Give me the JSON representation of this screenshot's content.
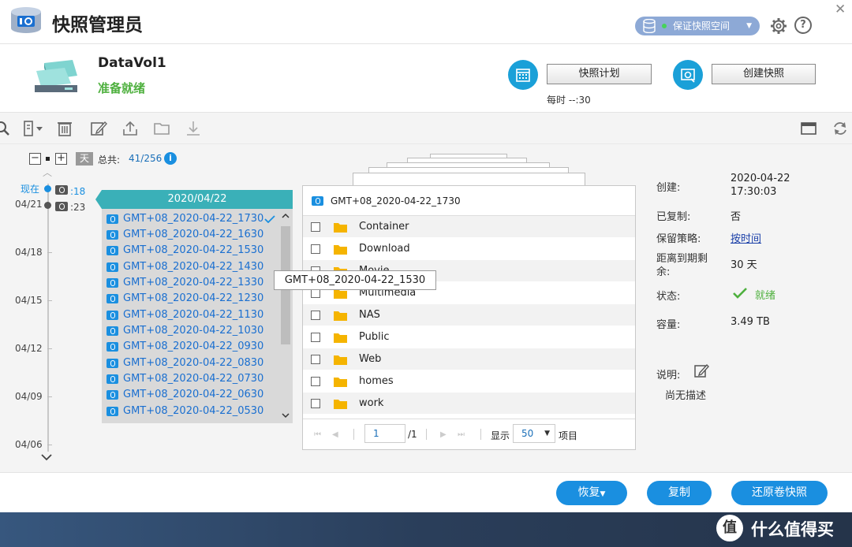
{
  "app": {
    "title": "快照管理员"
  },
  "header": {
    "guarantee_label": "保证快照空间",
    "help_label": "?",
    "close_label": "✕"
  },
  "volume": {
    "name": "DataVol1",
    "status": "准备就绪",
    "schedule_button": "快照计划",
    "schedule_text": "每时 --:30",
    "create_button": "创建快照"
  },
  "timeline": {
    "collapse_label": "−",
    "expand_label": "+",
    "day_label": "天",
    "total_label": "总共:",
    "total_value": "41/256",
    "now_label": "现在",
    "entries": [
      {
        "time": ":18",
        "color": "#1a8fe0"
      },
      {
        "time": ":23",
        "color": "#444444"
      }
    ],
    "dates": [
      "04/21",
      "04/18",
      "04/15",
      "04/12",
      "04/09",
      "04/06"
    ]
  },
  "snapshot_list": {
    "date_header": "2020/04/22",
    "items": [
      "GMT+08_2020-04-22_1730",
      "GMT+08_2020-04-22_1630",
      "GMT+08_2020-04-22_1530",
      "GMT+08_2020-04-22_1430",
      "GMT+08_2020-04-22_1330",
      "GMT+08_2020-04-22_1230",
      "GMT+08_2020-04-22_1130",
      "GMT+08_2020-04-22_1030",
      "GMT+08_2020-04-22_0930",
      "GMT+08_2020-04-22_0830",
      "GMT+08_2020-04-22_0730",
      "GMT+08_2020-04-22_0630",
      "GMT+08_2020-04-22_0530"
    ],
    "tooltip": "GMT+08_2020-04-22_1530"
  },
  "file_panel": {
    "title": "GMT+08_2020-04-22_1730",
    "files": [
      "Container",
      "Download",
      "Movie",
      "Multimedia",
      "NAS",
      "Public",
      "Web",
      "homes",
      "work"
    ],
    "page_value": "1",
    "page_total": "/1",
    "show_label": "显示",
    "per_page": "50",
    "items_label": "项目"
  },
  "details": {
    "created_label": "创建:",
    "created_date": "2020-04-22",
    "created_time": "17:30:03",
    "replicated_label": "已复制:",
    "replicated_value": "否",
    "retention_label": "保留策略:",
    "retention_value": "按时间",
    "expiry_label_1": "距离到期剩",
    "expiry_label_2": "余:",
    "expiry_value": "30 天",
    "status_label": "状态:",
    "status_value": "就绪",
    "capacity_label": "容量:",
    "capacity_value": "3.49 TB",
    "description_label": "说明:",
    "description_value": "尚无描述"
  },
  "footer": {
    "restore_button": "恢复",
    "copy_button": "复制",
    "revert_button": "还原卷快照"
  },
  "watermark": {
    "logo": "值",
    "text": "什么值得买"
  },
  "colors": {
    "accent": "#1a8fe0",
    "ready": "#4eb03e",
    "date_header": "#3ab0b8"
  }
}
